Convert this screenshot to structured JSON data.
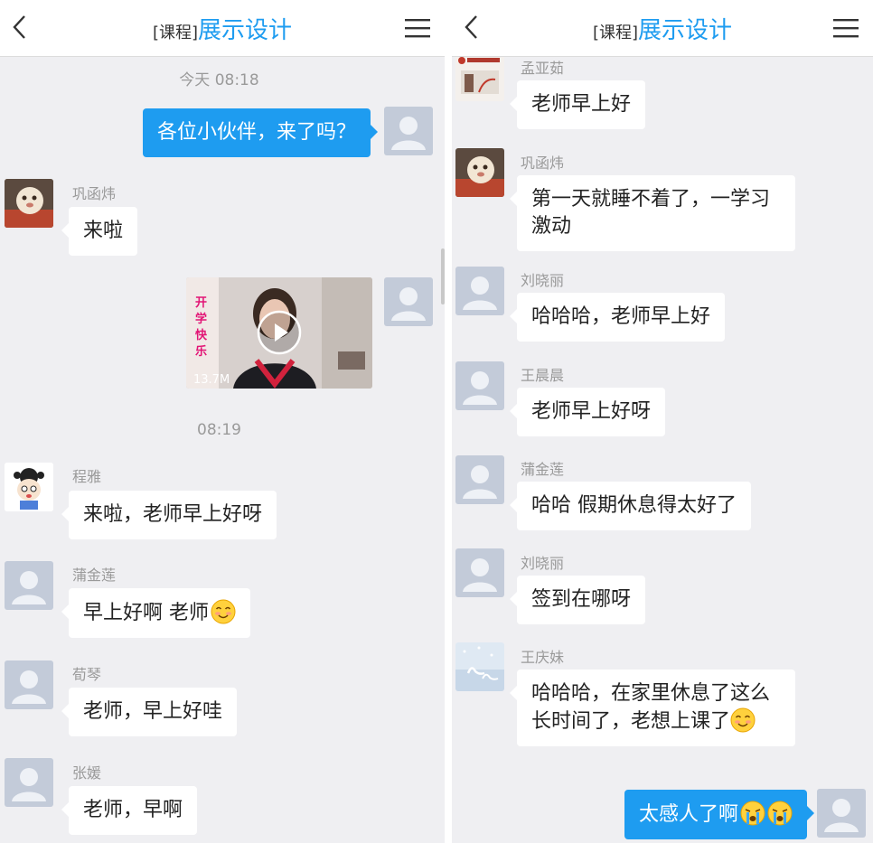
{
  "left": {
    "header": {
      "tag": "[课程]",
      "title": "展示设计"
    },
    "timestamps": [
      "今天 08:18",
      "08:19"
    ],
    "outgoing_text": "各位小伙伴，来了吗？",
    "video": {
      "overlay_text": "开学快乐",
      "size": "13.7M"
    },
    "messages": [
      {
        "name": "巩函炜",
        "text": "来啦"
      },
      {
        "name": "程雅",
        "text": "来啦，老师早上好呀"
      },
      {
        "name": "蒲金莲",
        "text": "早上好啊 老师"
      },
      {
        "name": "荀琴",
        "text": "老师，早上好哇"
      },
      {
        "name": "张媛",
        "text": "老师，早啊"
      }
    ]
  },
  "right": {
    "header": {
      "tag": "[课程]",
      "title": "展示设计"
    },
    "messages": [
      {
        "name": "孟亚茹",
        "text": "老师早上好"
      },
      {
        "name": "巩函炜",
        "text": "第一天就睡不着了，一学习激动"
      },
      {
        "name": "刘晓丽",
        "text": "哈哈哈，老师早上好"
      },
      {
        "name": "王晨晨",
        "text": "老师早上好呀"
      },
      {
        "name": "蒲金莲",
        "text": "哈哈 假期休息得太好了"
      },
      {
        "name": "刘晓丽",
        "text": "签到在哪呀"
      },
      {
        "name": "王庆妹",
        "text": "哈哈哈，在家里休息了这么长时间了，老想上课了"
      }
    ],
    "outgoing_text": "太感人了啊"
  },
  "icons": {
    "back": "back-arrow-icon",
    "menu": "menu-icon",
    "play": "play-icon",
    "smile_emoji": "smile-emoji-icon",
    "crying_emoji": "crying-emoji-icon",
    "default_avatar": "default-avatar-icon"
  },
  "colors": {
    "accent": "#1e9cf0",
    "chat_background": "#efeff2",
    "bubble_incoming": "#ffffff",
    "bubble_outgoing": "#1e9cf0",
    "meta_text": "#9a9a9a"
  }
}
